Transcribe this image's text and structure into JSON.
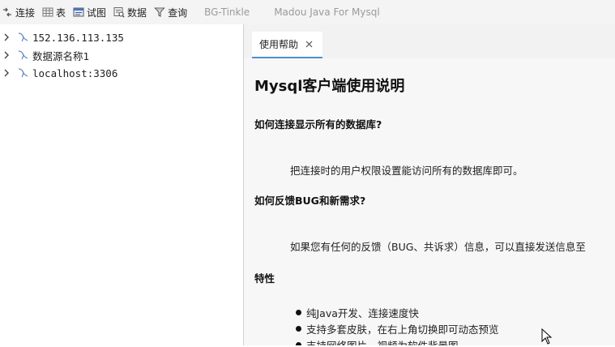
{
  "toolbar": {
    "buttons": [
      {
        "label": "连接",
        "icon": "connect-icon"
      },
      {
        "label": "表",
        "icon": "table-icon"
      },
      {
        "label": "试图",
        "icon": "view-icon"
      },
      {
        "label": "数据",
        "icon": "data-icon"
      },
      {
        "label": "查询",
        "icon": "query-icon"
      }
    ],
    "apps": [
      "BG-Tinkle",
      "Madou Java For Mysql"
    ]
  },
  "sidebar": {
    "connections": [
      {
        "label": "152.136.113.135",
        "icon": "mysql-dolphin-icon"
      },
      {
        "label": "数据源名称1",
        "icon": "mysql-dolphin-icon"
      },
      {
        "label": "localhost:3306",
        "icon": "mysql-dolphin-icon"
      }
    ]
  },
  "tabs": [
    {
      "label": "使用帮助",
      "active": true
    }
  ],
  "doc": {
    "title": "Mysql客户端使用说明",
    "q1": "如何连接显示所有的数据库?",
    "a1": "把连接时的用户权限设置能访问所有的数据库即可。",
    "q2": "如何反馈BUG和新需求?",
    "a2": "如果您有任何的反馈（BUG、共诉求）信息，可以直接发送信息至",
    "features_title": "特性",
    "features": [
      "纯Java开发、连接速度快",
      "支持多套皮肤，在右上角切换即可动态预览",
      "支持网络图片、视频为软件背景图"
    ]
  },
  "colors": {
    "toolbar_bg": "#f4f4f4",
    "panel_bg": "#f2f2f2",
    "tab_accent": "#4d8fd1",
    "app_name_gray": "#9a9a9a"
  }
}
